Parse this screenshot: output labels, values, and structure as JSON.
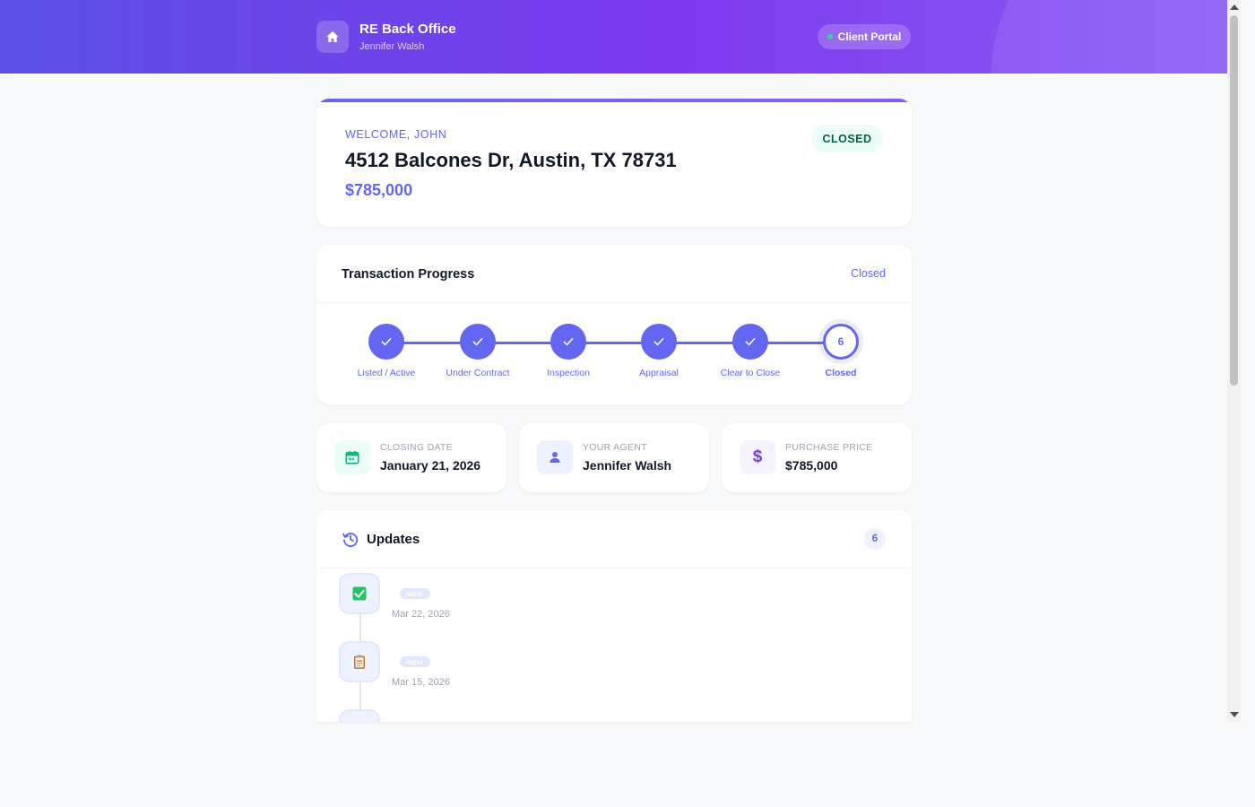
{
  "header": {
    "brand_title": "RE Back Office",
    "brand_subtitle": "Jennifer Walsh",
    "portal_label": "Client Portal"
  },
  "property": {
    "welcome": "WELCOME, JOHN",
    "address": "4512 Balcones Dr, Austin, TX 78731",
    "price": "$785,000",
    "status": "CLOSED"
  },
  "progress": {
    "title": "Transaction Progress",
    "status": "Closed",
    "steps": [
      {
        "label": "Listed / Active",
        "state": "done"
      },
      {
        "label": "Under Contract",
        "state": "done"
      },
      {
        "label": "Inspection",
        "state": "done"
      },
      {
        "label": "Appraisal",
        "state": "done"
      },
      {
        "label": "Clear to Close",
        "state": "done"
      },
      {
        "label": "Closed",
        "state": "current",
        "number": "6"
      }
    ]
  },
  "info_cards": [
    {
      "label": "CLOSING DATE",
      "value": "January 21, 2026",
      "icon": "calendar-icon",
      "color": "#10b981"
    },
    {
      "label": "YOUR AGENT",
      "value": "Jennifer Walsh",
      "icon": "person-icon",
      "color": "#6366f1"
    },
    {
      "label": "PURCHASE PRICE",
      "value": "$785,000",
      "icon": "dollar-icon",
      "color": "#7c3aed"
    }
  ],
  "updates": {
    "title": "Updates",
    "count": "6",
    "items": [
      {
        "icon": "checkbox-icon",
        "badge": "NEW",
        "date": "Mar 22, 2026"
      },
      {
        "icon": "clipboard-icon",
        "badge": "NEW",
        "date": "Mar 15, 2026"
      }
    ]
  },
  "colors": {
    "accent": "#6366f1",
    "header_start": "#5b4fe6",
    "header_end": "#8b5cf6",
    "success_bg": "#ecfdf5",
    "success_text": "#065f46"
  }
}
